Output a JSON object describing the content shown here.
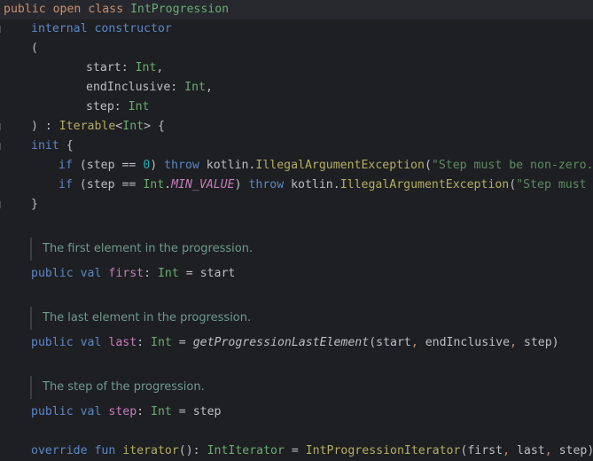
{
  "code": {
    "l1": {
      "kw1": "public",
      "kw2": "open",
      "kw3": "class",
      "name": "IntProgression"
    },
    "l2": {
      "kw1": "internal",
      "kw2": "constructor"
    },
    "l3": {
      "paren": "("
    },
    "l4": {
      "name": "start",
      "sep": ": ",
      "type": "Int",
      "tail": ","
    },
    "l5": {
      "name": "endInclusive",
      "sep": ": ",
      "type": "Int",
      "tail": ","
    },
    "l6": {
      "name": "step",
      "sep": ": ",
      "type": "Int"
    },
    "l7": {
      "start": ") : ",
      "type": "Iterable",
      "lt": "<",
      "arg": "Int",
      "end": "> {"
    },
    "l8": {
      "kw": "init",
      "brace": " {"
    },
    "l9": {
      "kw": "if",
      "open": " (",
      "name": "step",
      "op": " == ",
      "num": "0",
      "close": ") ",
      "kw2": "throw",
      "pkg": " kotlin.",
      "cls": "IllegalArgumentException",
      "p": "(",
      "str": "\"Step must be non-zero.\")"
    },
    "l10": {
      "kw": "if",
      "open": " (",
      "name": "step",
      "op": " == ",
      "t": "Int",
      "dot": ".",
      "c": "MIN_VALUE",
      "close": ") ",
      "kw2": "throw",
      "pkg": " kotlin.",
      "cls": "IllegalArgumentException",
      "p": "(",
      "str": "\"Step must be"
    },
    "l11": {
      "brace": "}"
    },
    "doc1": "The first element in the progression.",
    "l13": {
      "kw1": "public",
      "kw2": "val",
      "name": "first",
      "sep": ": ",
      "type": "Int",
      "eq": " = ",
      "val": "start"
    },
    "doc2": "The last element in the progression.",
    "l15": {
      "kw1": "public",
      "kw2": "val",
      "name": "last",
      "sep": ": ",
      "type": "Int",
      "eq": " = ",
      "fn": "getProgressionLastElement",
      "p": "(",
      "a1": "start",
      "c1": ", ",
      "a2": "endInclusive",
      "c2": ", ",
      "a3": "step",
      "end": ")"
    },
    "doc3": "The step of the progression.",
    "l17": {
      "kw1": "public",
      "kw2": "val",
      "name": "step",
      "sep": ": ",
      "type": "Int",
      "eq": " = ",
      "val": "step"
    },
    "l18": {
      "kw1": "override",
      "kw2": "fun",
      "fn": "iterator",
      "p": "(): ",
      "type": "IntIterator",
      "eq": " = ",
      "cls": "IntProgressionIterator",
      "open": "(",
      "a1": "first",
      "c1": ", ",
      "a2": "last",
      "c2": ", ",
      "a3": "step",
      "end": ")"
    }
  }
}
